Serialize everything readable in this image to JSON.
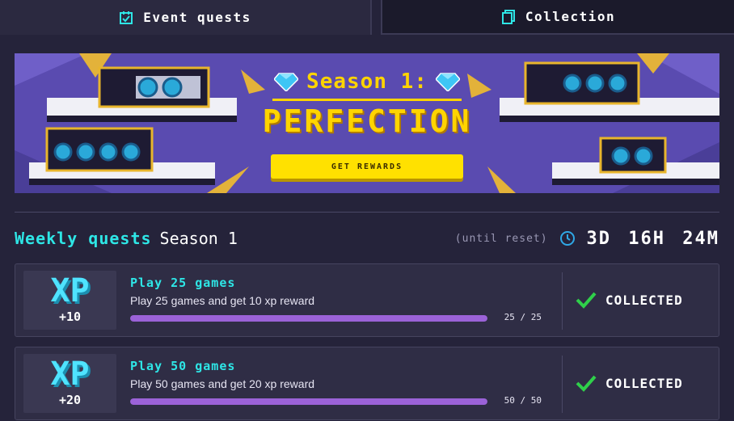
{
  "tabs": {
    "event": {
      "label": "Event quests",
      "icon": "calendar-check-icon"
    },
    "collection": {
      "label": "Collection",
      "icon": "cards-icon"
    }
  },
  "banner": {
    "season_title": "Season 1:",
    "subtitle": "PERFECTION",
    "button_label": "GET REWARDS",
    "icon": "diamond-icon"
  },
  "weekly": {
    "label": "Weekly quests",
    "season": "Season 1",
    "reset_label": "(until reset)",
    "countdown": "3D 16H 24M",
    "icon": "clock-icon"
  },
  "quests": [
    {
      "xp_label": "XP",
      "xp_amount": "+10",
      "title": "Play 25 games",
      "description": "Play 25 games and get 10 xp reward",
      "progress_text": "25 / 25",
      "progress_fraction": 1.0,
      "status": "COLLECTED"
    },
    {
      "xp_label": "XP",
      "xp_amount": "+20",
      "title": "Play 50 games",
      "description": "Play 50 games and get 20 xp reward",
      "progress_text": "50 / 50",
      "progress_fraction": 1.0,
      "status": "COLLECTED"
    }
  ],
  "colors": {
    "accent_cyan": "#2ee6e6",
    "progress": "#9b62d8",
    "banner_yellow": "#ffd400",
    "check_green": "#2fd04a"
  }
}
